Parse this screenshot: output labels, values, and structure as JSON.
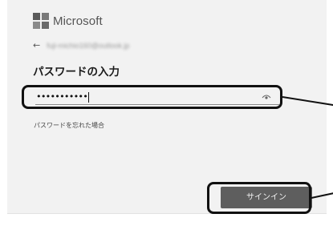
{
  "header": {
    "brand": "Microsoft",
    "logo_icon": "microsoft-logo-icon"
  },
  "account": {
    "back_icon": "back-arrow-icon",
    "back_glyph": "←",
    "email": "fuji-michio160@outlook.jp"
  },
  "page": {
    "title": "パスワードの入力"
  },
  "password": {
    "value": "•••••••••••",
    "reveal_icon": "eye-icon"
  },
  "links": {
    "forgot_password": "パスワードを忘れた場合"
  },
  "actions": {
    "sign_in": "サインイン"
  },
  "colors": {
    "button_bg": "#5e5e5e",
    "highlight_border": "#111111",
    "panel_bg": "#f2f2f2"
  }
}
